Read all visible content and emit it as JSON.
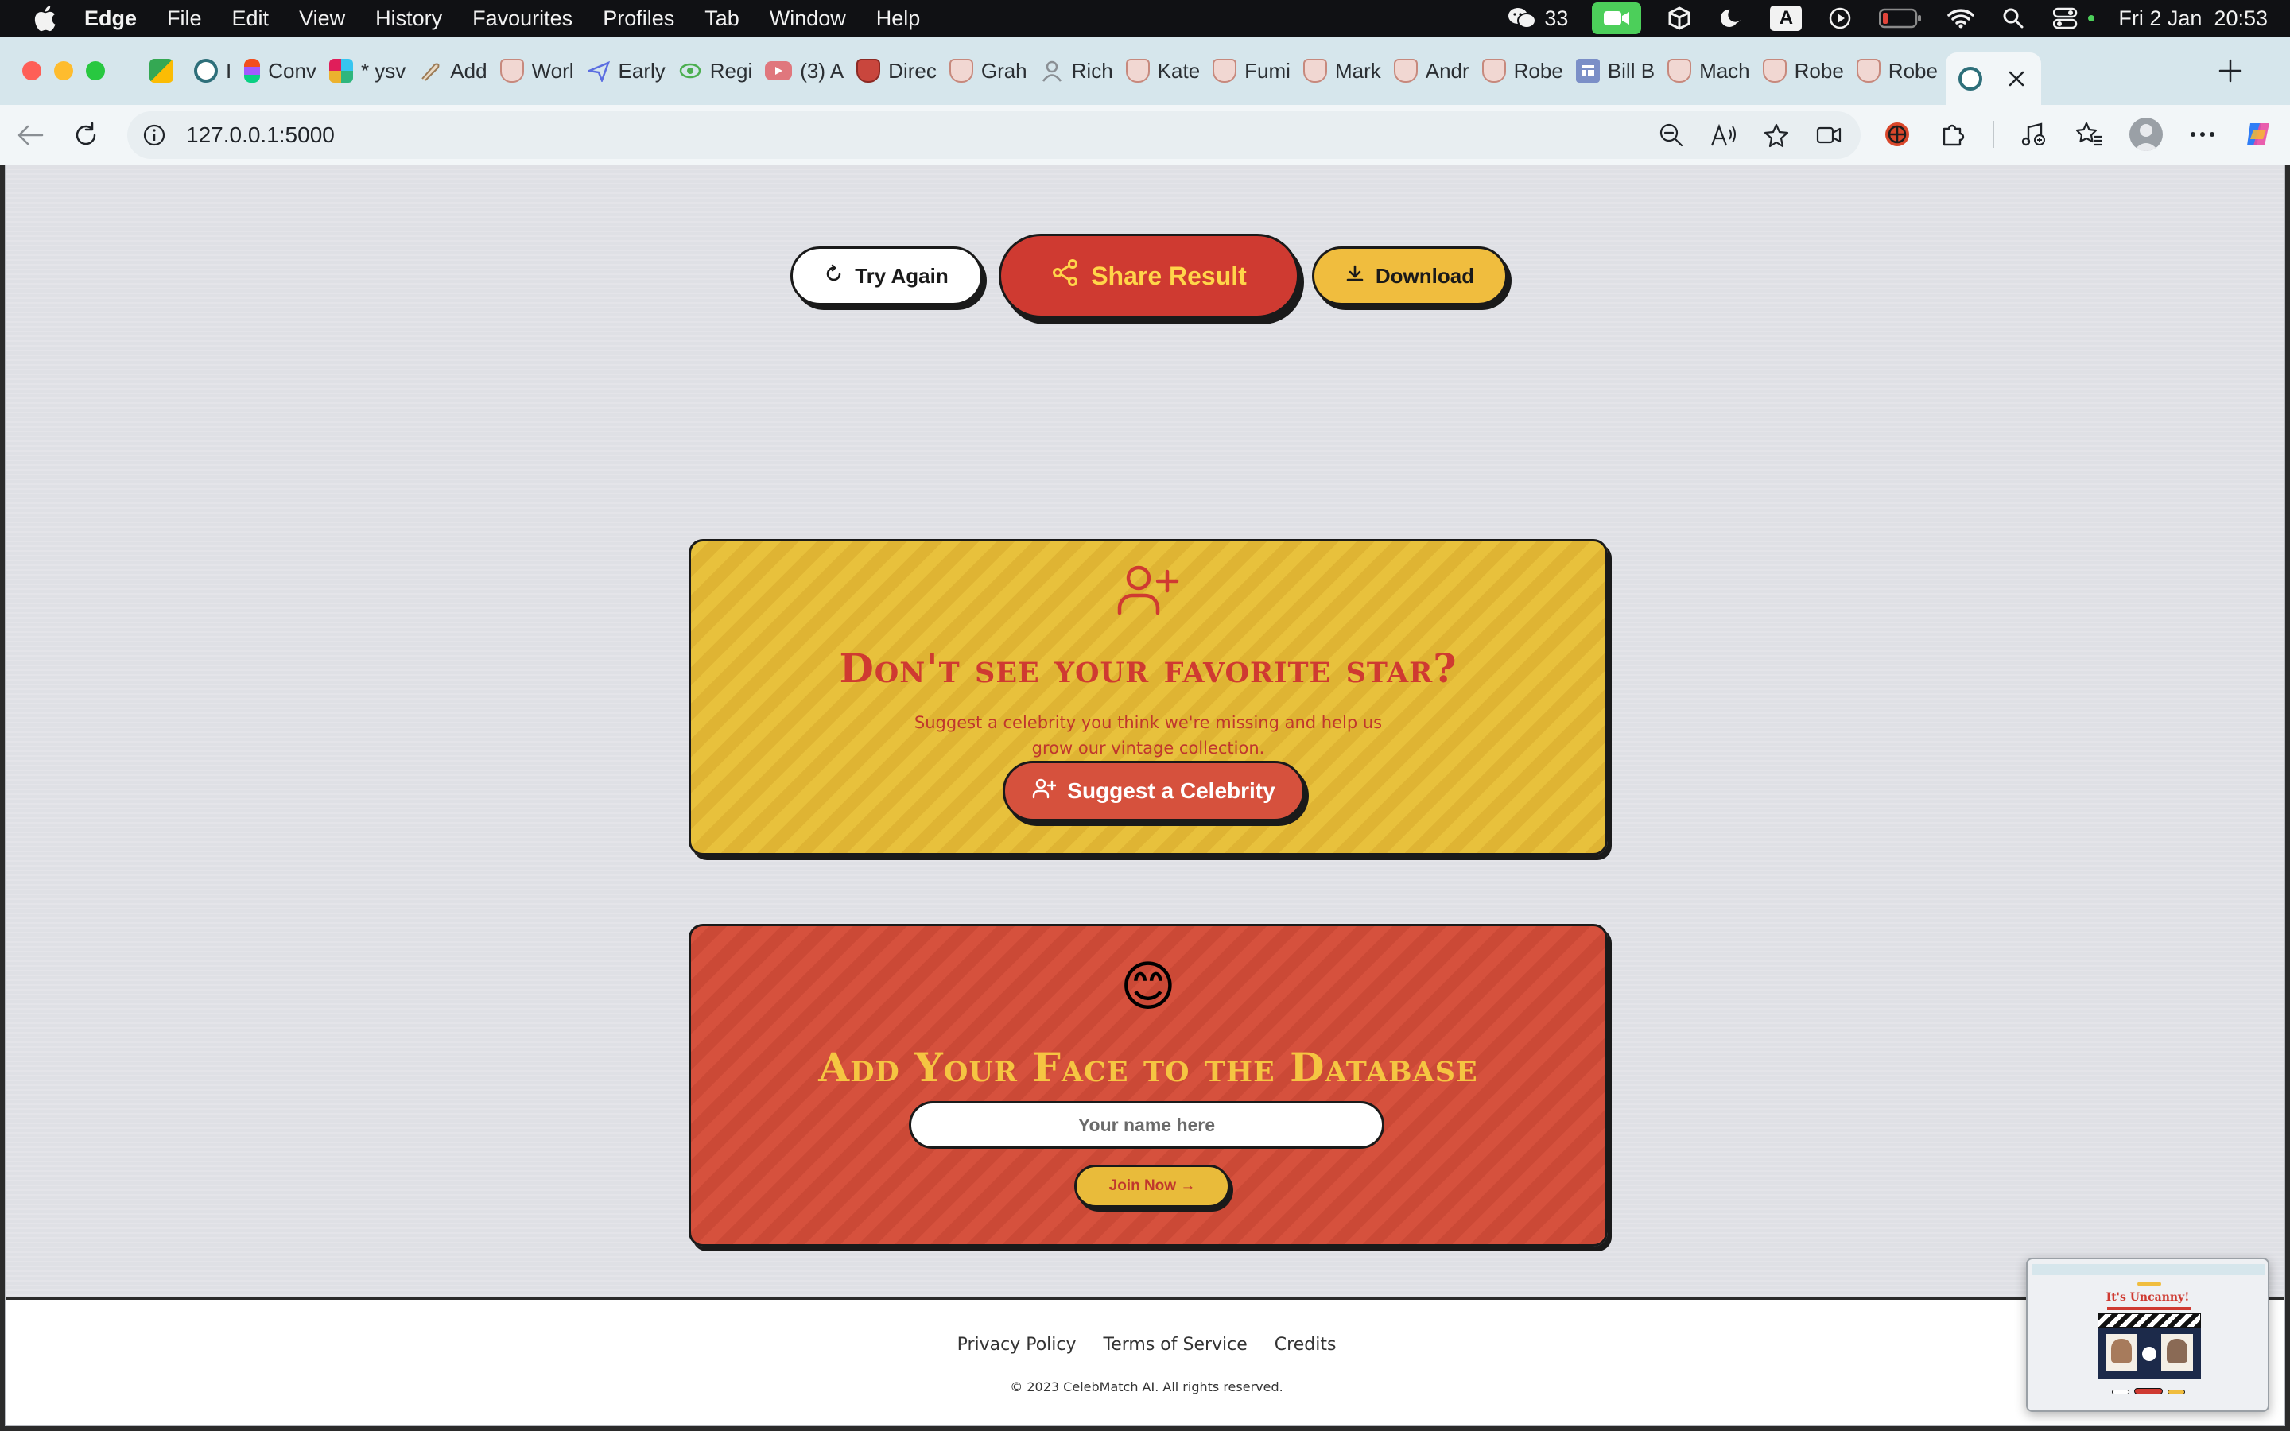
{
  "menubar": {
    "app": "Edge",
    "items": [
      "File",
      "Edit",
      "View",
      "History",
      "Favourites",
      "Profiles",
      "Tab",
      "Window",
      "Help"
    ],
    "wechat_count": "33",
    "input_source": "A",
    "datetime": "Fri 2 Jan  20:53"
  },
  "tabs": [
    {
      "label": "",
      "icon": "meet-icon"
    },
    {
      "label": "I",
      "icon": "circle-app-icon"
    },
    {
      "label": "Conv",
      "icon": "figma-icon"
    },
    {
      "label": "* ysv",
      "icon": "slack-icon"
    },
    {
      "label": "Add",
      "icon": "feather-icon"
    },
    {
      "label": "Worl",
      "icon": "shield-icon"
    },
    {
      "label": "Early",
      "icon": "plane-icon"
    },
    {
      "label": "Regi",
      "icon": "eye-icon"
    },
    {
      "label": "(3) A",
      "icon": "youtube-icon"
    },
    {
      "label": "Direc",
      "icon": "shield-icon"
    },
    {
      "label": "Grah",
      "icon": "shield-icon"
    },
    {
      "label": "Rich",
      "icon": "person-icon"
    },
    {
      "label": "Kate",
      "icon": "shield-icon"
    },
    {
      "label": "Fumi",
      "icon": "shield-icon"
    },
    {
      "label": "Mark",
      "icon": "shield-icon"
    },
    {
      "label": "Andr",
      "icon": "shield-icon"
    },
    {
      "label": "Robe",
      "icon": "shield-icon"
    },
    {
      "label": "Bill B",
      "icon": "layout-icon"
    },
    {
      "label": "Mach",
      "icon": "shield-icon"
    },
    {
      "label": "Robe",
      "icon": "shield-icon"
    },
    {
      "label": "Robe",
      "icon": "shield-icon"
    }
  ],
  "address": {
    "url": "127.0.0.1:5000"
  },
  "page": {
    "try_again": "Try Again",
    "share_result": "Share Result",
    "download": "Download",
    "suggest": {
      "title": "Don't see your favorite star?",
      "description": "Suggest a celebrity you think we're missing and help us grow our vintage collection.",
      "button": "Suggest a Celebrity"
    },
    "face": {
      "emoji": "😊",
      "title": "Add Your Face to the Database",
      "placeholder": "Your name here",
      "button": "Join Now →"
    },
    "footer": {
      "privacy": "Privacy Policy",
      "terms": "Terms of Service",
      "credits": "Credits",
      "copyright": "© 2023 CelebMatch AI. All rights reserved."
    }
  },
  "thumbnail": {
    "title": "It's Uncanny!"
  },
  "colors": {
    "red": "#cf3a31",
    "yellow": "#f0bd3e",
    "page_bg": "#dfe0e5"
  }
}
